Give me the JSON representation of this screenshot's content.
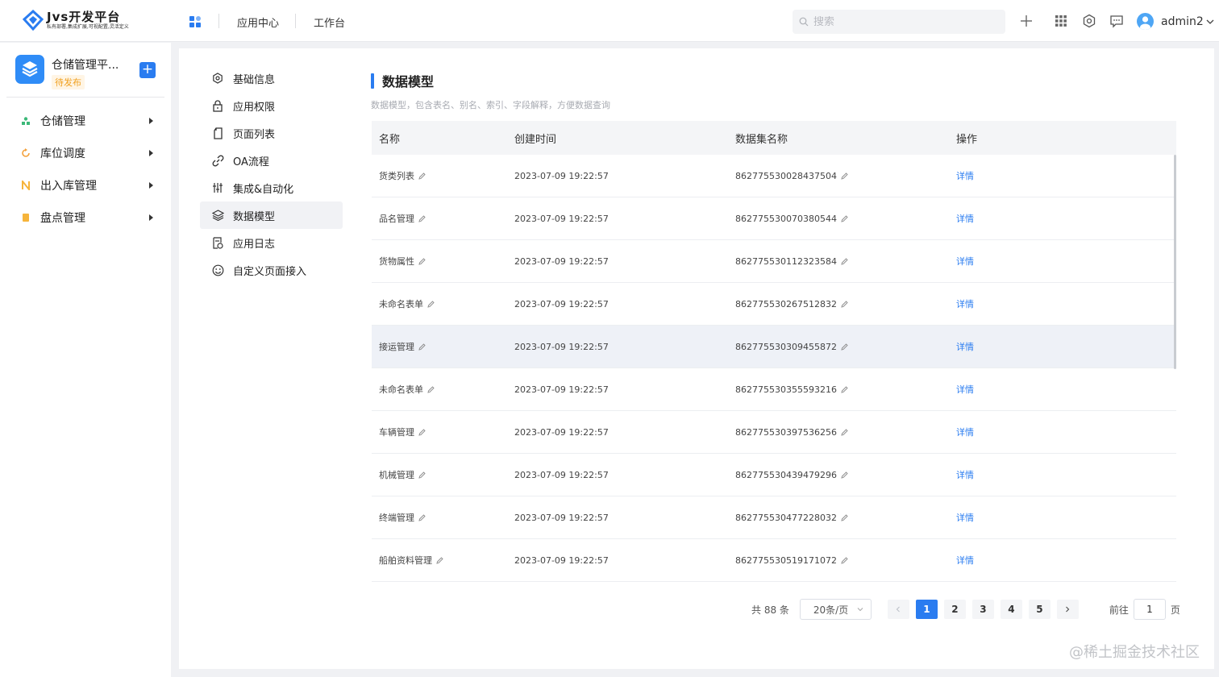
{
  "header": {
    "logo_title": "Jvs开发平台",
    "logo_tagline": "私有部署,集成扩展,可视配置,灵活定义",
    "nav": [
      "应用中心",
      "工作台"
    ],
    "search_placeholder": "搜索",
    "username": "admin2",
    "icons": [
      "apps-grid-icon",
      "plus-icon",
      "grid-icon",
      "gear-icon",
      "message-icon",
      "user-avatar-icon",
      "chevron-down-icon"
    ]
  },
  "sidebar": {
    "app_name": "仓储管理平...",
    "app_status": "待发布",
    "add_label": "+",
    "items": [
      {
        "label": "仓储管理",
        "icon": "people-icon",
        "color": "#3cb878"
      },
      {
        "label": "库位调度",
        "icon": "refresh-icon",
        "color": "#f4a13a"
      },
      {
        "label": "出入库管理",
        "icon": "n-icon",
        "color": "#f6b43b"
      },
      {
        "label": "盘点管理",
        "icon": "box-icon",
        "color": "#f6b43b"
      }
    ]
  },
  "subnav": {
    "items": [
      {
        "label": "基础信息",
        "icon": "gear-icon"
      },
      {
        "label": "应用权限",
        "icon": "lock-icon"
      },
      {
        "label": "页面列表",
        "icon": "page-icon"
      },
      {
        "label": "OA流程",
        "icon": "link-icon"
      },
      {
        "label": "集成&自动化",
        "icon": "sliders-icon"
      },
      {
        "label": "数据模型",
        "icon": "layers-icon",
        "active": true
      },
      {
        "label": "应用日志",
        "icon": "log-icon"
      },
      {
        "label": "自定义页面接入",
        "icon": "smile-icon"
      }
    ]
  },
  "main": {
    "title": "数据模型",
    "description": "数据模型，包含表名、别名、索引、字段解释，方便数据查询",
    "table": {
      "columns": [
        "名称",
        "创建时间",
        "数据集名称",
        "操作"
      ],
      "rows": [
        {
          "name": "货类列表",
          "time": "2023-07-09 19:22:57",
          "dataset": "862775530028437504",
          "action": "详情"
        },
        {
          "name": "品名管理",
          "time": "2023-07-09 19:22:57",
          "dataset": "862775530070380544",
          "action": "详情"
        },
        {
          "name": "货物属性",
          "time": "2023-07-09 19:22:57",
          "dataset": "862775530112323584",
          "action": "详情"
        },
        {
          "name": "未命名表单",
          "time": "2023-07-09 19:22:57",
          "dataset": "862775530267512832",
          "action": "详情"
        },
        {
          "name": "接运管理",
          "time": "2023-07-09 19:22:57",
          "dataset": "862775530309455872",
          "action": "详情"
        },
        {
          "name": "未命名表单",
          "time": "2023-07-09 19:22:57",
          "dataset": "862775530355593216",
          "action": "详情"
        },
        {
          "name": "车辆管理",
          "time": "2023-07-09 19:22:57",
          "dataset": "862775530397536256",
          "action": "详情"
        },
        {
          "name": "机械管理",
          "time": "2023-07-09 19:22:57",
          "dataset": "862775530439479296",
          "action": "详情"
        },
        {
          "name": "终端管理",
          "time": "2023-07-09 19:22:57",
          "dataset": "862775530477228032",
          "action": "详情"
        },
        {
          "name": "船舶资料管理",
          "time": "2023-07-09 19:22:57",
          "dataset": "862775530519171072",
          "action": "详情"
        }
      ]
    },
    "pagination": {
      "total": "共 88 条",
      "page_size": "20条/页",
      "pages": [
        "1",
        "2",
        "3",
        "4",
        "5"
      ],
      "current": "1",
      "goto_label": "前往",
      "goto_value": "1",
      "unit": "页"
    }
  },
  "credit": "@稀土掘金技术社区",
  "colors": {
    "accent": "#2a7cf0",
    "brand": "#2f8cf7"
  }
}
